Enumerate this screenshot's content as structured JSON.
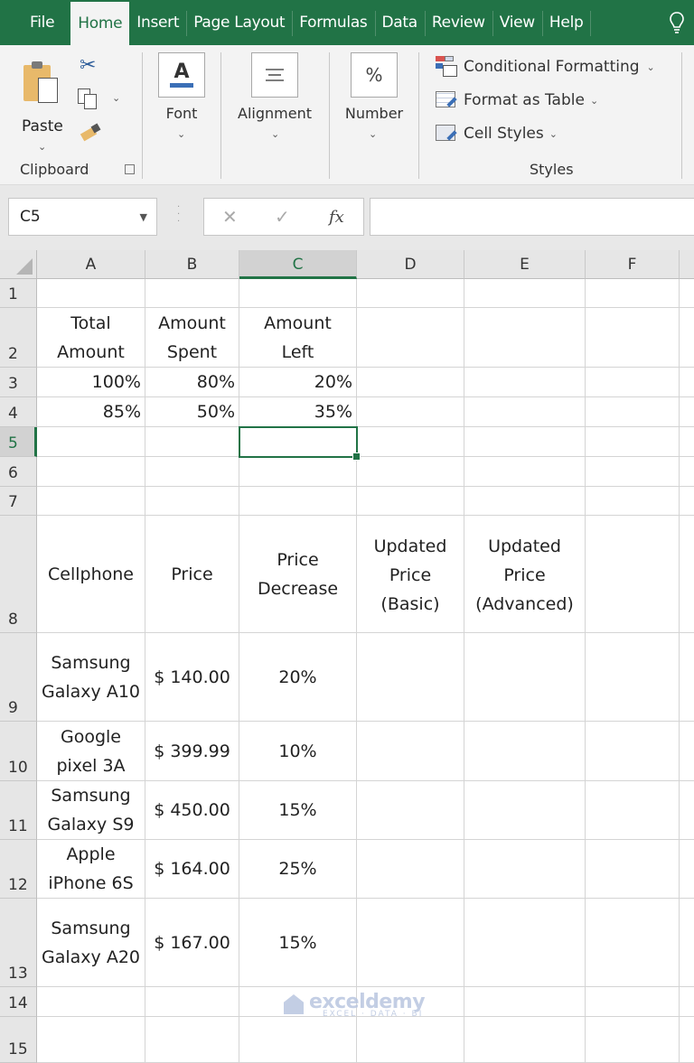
{
  "menu": {
    "tabs": [
      {
        "label": "File"
      },
      {
        "label": "Home",
        "active": true
      },
      {
        "label": "Insert"
      },
      {
        "label": "Page Layout"
      },
      {
        "label": "Formulas"
      },
      {
        "label": "Data"
      },
      {
        "label": "Review"
      },
      {
        "label": "View"
      },
      {
        "label": "Help"
      }
    ],
    "tell_me_icon": "lightbulb-icon"
  },
  "ribbon": {
    "clipboard": {
      "paste_label": "Paste",
      "group_label": "Clipboard",
      "icons": [
        "paste-icon",
        "cut-icon",
        "copy-icon",
        "format-painter-icon",
        "dialog-launcher-icon"
      ]
    },
    "font": {
      "label": "Font",
      "icon_glyph": "A"
    },
    "alignment": {
      "label": "Alignment"
    },
    "number": {
      "label": "Number",
      "icon_glyph": "%"
    },
    "styles": {
      "items": [
        {
          "label": "Conditional Formatting"
        },
        {
          "label": "Format as Table"
        },
        {
          "label": "Cell Styles"
        }
      ],
      "group_label": "Styles"
    }
  },
  "formula_bar": {
    "name_box": "C5",
    "cancel_glyph": "✕",
    "enter_glyph": "✓",
    "fx_glyph": "fx",
    "formula": ""
  },
  "sheet": {
    "columns": [
      "A",
      "B",
      "C",
      "D",
      "E",
      "F"
    ],
    "selected_column": "C",
    "selected_row": "5",
    "active_cell": "C5",
    "rows": [
      "1",
      "2",
      "3",
      "4",
      "5",
      "6",
      "7",
      "8",
      "9",
      "10",
      "11",
      "12",
      "13",
      "14",
      "15"
    ],
    "table1": {
      "headers": [
        "Total\nAmount",
        "Amount\nSpent",
        "Amount\nLeft"
      ],
      "rows": [
        [
          "100%",
          "80%",
          "20%"
        ],
        [
          "85%",
          "50%",
          "35%"
        ]
      ]
    },
    "table2": {
      "headers": [
        "Cellphone",
        "Price",
        "Price\nDecrease",
        "Updated\nPrice\n(Basic)",
        "Updated\nPrice\n(Advanced)"
      ],
      "rows": [
        [
          "Samsung\nGalaxy A10",
          "$ 140.00",
          "20%"
        ],
        [
          "Google\npixel 3A",
          "$ 399.99",
          "10%"
        ],
        [
          "Samsung\nGalaxy S9",
          "$ 450.00",
          "15%"
        ],
        [
          "Apple\niPhone 6S",
          "$ 164.00",
          "25%"
        ],
        [
          "Samsung\nGalaxy A20",
          "$ 167.00",
          "15%"
        ]
      ]
    }
  },
  "watermark": {
    "main": "exceldemy",
    "sub": "EXCEL · DATA · BI"
  },
  "colors": {
    "accent": "#217346"
  }
}
